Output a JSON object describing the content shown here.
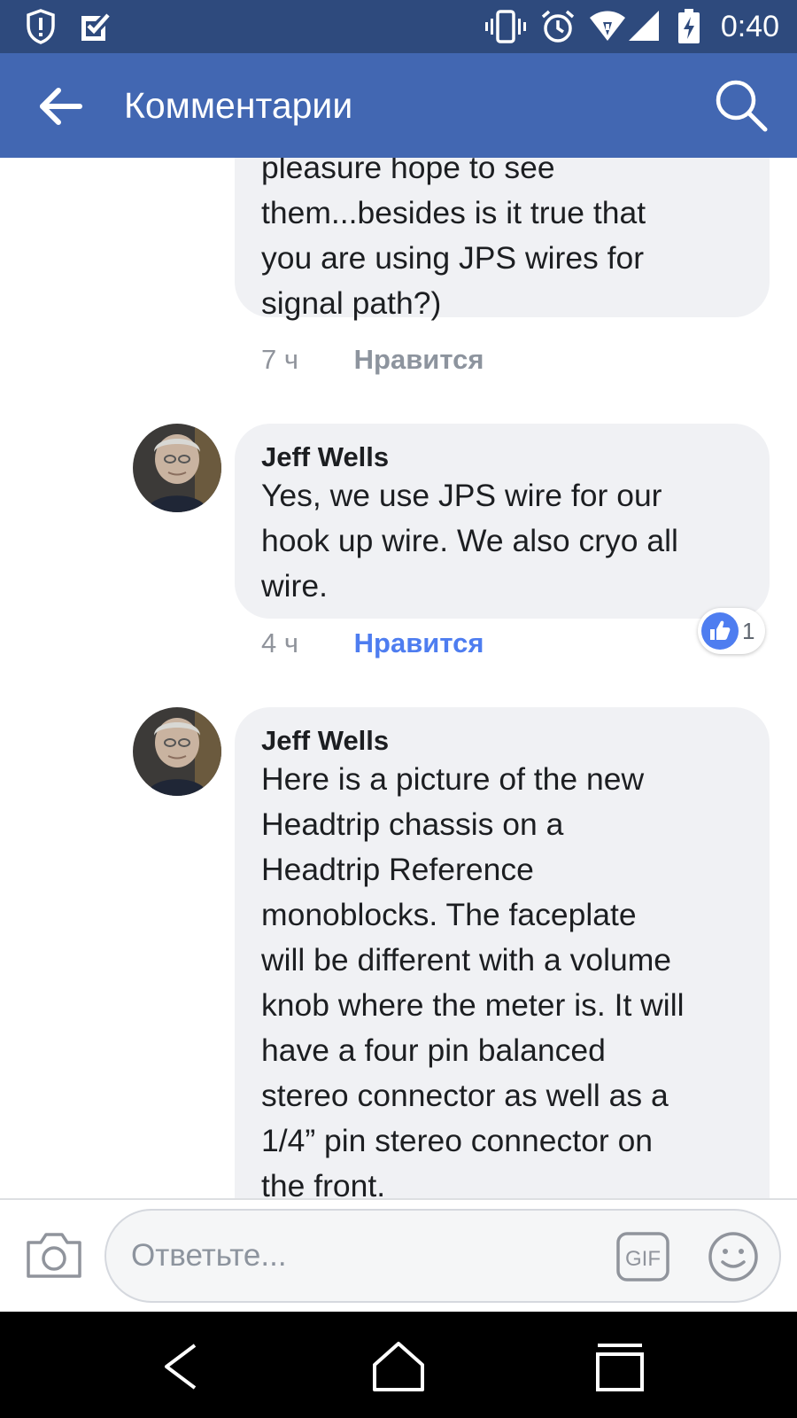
{
  "status_bar": {
    "time": "0:40",
    "icons": [
      "shield-alert-icon",
      "checkbox-icon",
      "vibrate-icon",
      "alarm-icon",
      "wifi-icon",
      "signal-icon",
      "battery-charging-icon"
    ]
  },
  "header": {
    "back_icon": "arrow-left-icon",
    "title": "Комментарии",
    "search_icon": "search-icon"
  },
  "comments": [
    {
      "author": "",
      "text": "pleasure hope to see\nthem...besides is it true that\nyou are using JPS wires for\nsignal path?)",
      "time": "7 ч",
      "like_label": "Нравится",
      "liked": false
    },
    {
      "author": "Jeff Wells",
      "text": "Yes, we use JPS wire for our\nhook up wire. We also cryo all\nwire.",
      "time": "4 ч",
      "like_label": "Нравится",
      "liked": true,
      "reaction_count": "1"
    },
    {
      "author": "Jeff Wells",
      "text": "Here is a picture of the new\nHeadtrip chassis on a\nHeadtrip Reference\nmonoblocks. The faceplate\nwill be different with a volume\nknob where the meter is. It will\nhave a four pin balanced\nstereo connector as well as a\n1/4” pin stereo connector on\nthe front."
    }
  ],
  "composer": {
    "placeholder": "Ответьте...",
    "gif_label": "GIF",
    "camera_icon": "camera-icon",
    "emoji_icon": "smiley-icon"
  },
  "colors": {
    "status_bar": "#2e4a7d",
    "header": "#4267b2",
    "bubble": "#f0f1f4",
    "like_active": "#4e7df0",
    "nav_bar": "#000000"
  }
}
